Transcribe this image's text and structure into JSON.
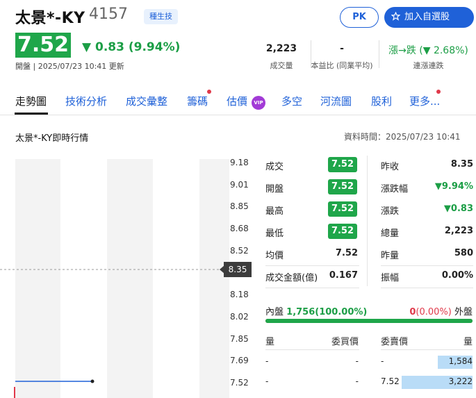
{
  "header": {
    "name": "太景*-KY",
    "code": "4157",
    "sector": "種生技",
    "pk_label": "PK",
    "watchlist_label": "加入自選股",
    "price": "7.52",
    "change": "0.83 (9.94%)",
    "updated": "開盤 | 2025/07/23 10:41 更新",
    "stats": [
      {
        "value": "2,223",
        "label": "成交量"
      },
      {
        "value": "-",
        "label": "本益比 (同業平均)"
      },
      {
        "value": "漲→跌 (▼ 2.68%)",
        "label": "連漲連跌"
      }
    ]
  },
  "tabs": [
    "走勢圖",
    "技術分析",
    "成交彙整",
    "籌碼",
    "估價",
    "多空",
    "河流圖",
    "股利",
    "更多..."
  ],
  "vip_label": "VIP",
  "section": {
    "title": "太景*-KY即時行情",
    "data_time": "資料時間：2025/07/23 10:41"
  },
  "chart": {
    "yticks": [
      "9.18",
      "9.01",
      "8.85",
      "8.68",
      "8.52",
      "8.35",
      "8.18",
      "8.02",
      "7.85",
      "7.69",
      "7.52"
    ],
    "ref_label": "8.35"
  },
  "chart_data": {
    "type": "line",
    "y_axis": {
      "min": 7.52,
      "max": 9.18,
      "ticks": [
        9.18,
        9.01,
        8.85,
        8.68,
        8.52,
        8.35,
        8.18,
        8.02,
        7.85,
        7.69,
        7.52
      ]
    },
    "reference": 8.35,
    "series": [
      {
        "values": [
          7.52,
          7.52
        ]
      }
    ]
  },
  "quote": {
    "left": [
      {
        "label": "成交",
        "value": "7.52",
        "boxed": true
      },
      {
        "label": "開盤",
        "value": "7.52",
        "boxed": true
      },
      {
        "label": "最高",
        "value": "7.52",
        "boxed": true
      },
      {
        "label": "最低",
        "value": "7.52",
        "boxed": true
      },
      {
        "label": "均價",
        "value": "7.52",
        "boxed": false
      },
      {
        "label": "成交金額(億)",
        "value": "0.167",
        "boxed": false
      }
    ],
    "right": [
      {
        "label": "昨收",
        "value": "8.35"
      },
      {
        "label": "漲跌幅",
        "value": "▼9.94%"
      },
      {
        "label": "漲跌",
        "value": "▼0.83"
      },
      {
        "label": "總量",
        "value": "2,223"
      },
      {
        "label": "昨量",
        "value": "580"
      },
      {
        "label": "振幅",
        "value": "0.00%"
      }
    ]
  },
  "inout": {
    "in_label": "內盤",
    "in_value": "1,756(100.00%)",
    "out_value_red": "0",
    "out_value_rest": "(0.00%)",
    "out_label": "外盤",
    "in_fraction": 1.0
  },
  "orderbook": {
    "headers": [
      "量",
      "委買價",
      "委賣價",
      "量"
    ],
    "rows": [
      {
        "bid_vol": "-",
        "bid_price": "-",
        "ask_price": "-",
        "ask_vol": "1,584",
        "ask_fraction": 0.49
      },
      {
        "bid_vol": "-",
        "bid_price": "-",
        "ask_price": "7.52",
        "ask_vol": "3,222",
        "ask_fraction": 1.0
      }
    ]
  },
  "colors": {
    "accent": "#1f61d8",
    "up": "#e0394a",
    "down": "#1c9e46",
    "vip": "#a23bd6"
  }
}
